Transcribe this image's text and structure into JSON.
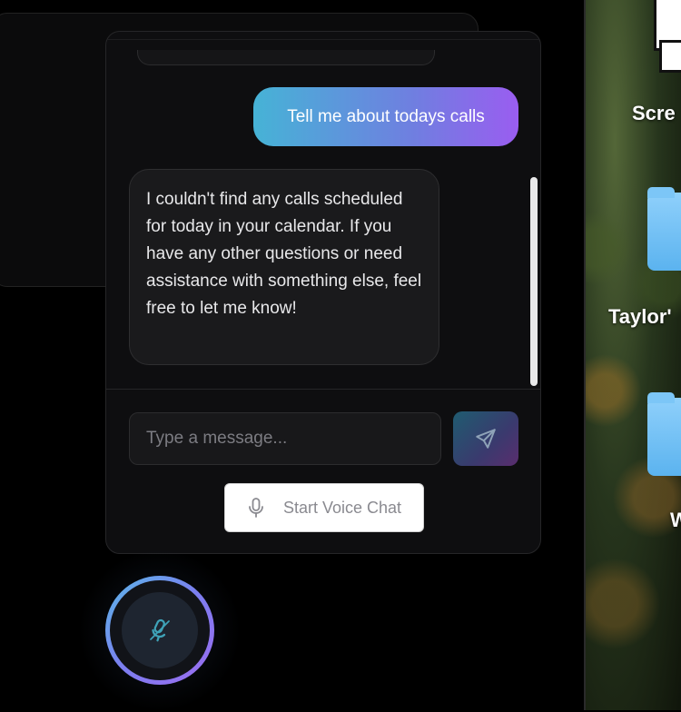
{
  "desktop": {
    "labels": [
      "Scre",
      "Taylor'",
      "W"
    ]
  },
  "chat": {
    "messages": [
      {
        "role": "user",
        "text": "Tell me about todays calls"
      },
      {
        "role": "assistant",
        "text": "I couldn't find any calls scheduled for today in your calendar. If you have any other questions or need assistance with something else, feel free to let me know!"
      }
    ],
    "input_placeholder": "Type a message...",
    "voice_button_label": "Start Voice Chat"
  },
  "colors": {
    "user_bubble_start": "#46b3d6",
    "user_bubble_end": "#9a5df0",
    "panel_bg": "#0e0e10"
  },
  "icons": {
    "send": "send-icon",
    "mic": "microphone-icon",
    "orb": "mic-off-icon"
  }
}
